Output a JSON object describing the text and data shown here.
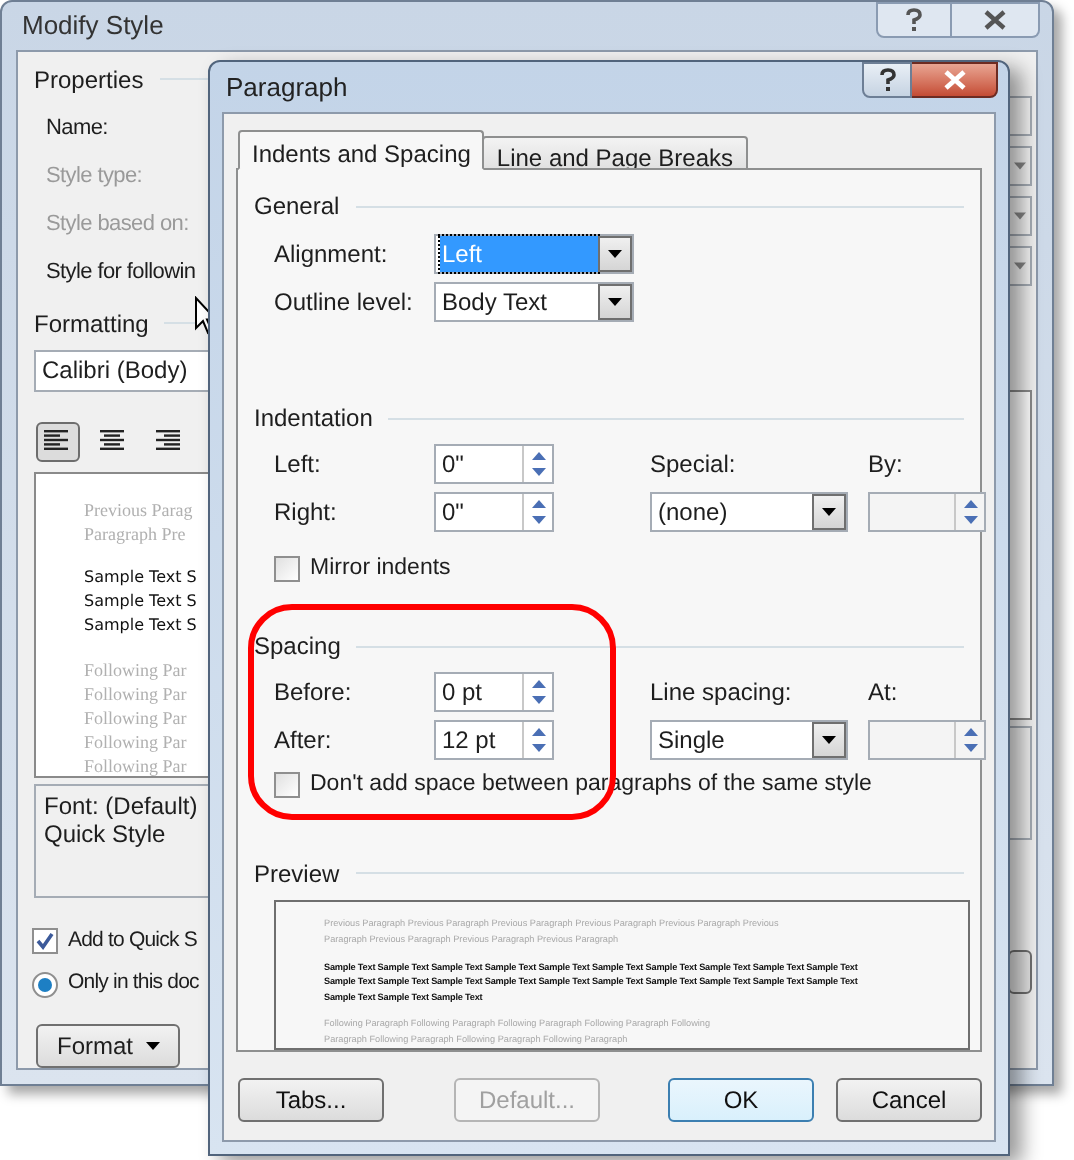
{
  "modify_style": {
    "title": "Modify Style",
    "properties_heading": "Properties",
    "labels": [
      {
        "text": "Name:",
        "disabled": false
      },
      {
        "text": "Style type:",
        "disabled": true
      },
      {
        "text": "Style based on:",
        "disabled": true
      },
      {
        "text": "Style for followin",
        "disabled": false
      }
    ],
    "formatting_heading": "Formatting",
    "font": "Calibri (Body)",
    "align_buttons": [
      {
        "kind": "left",
        "selected": true
      },
      {
        "kind": "center",
        "selected": false
      },
      {
        "kind": "right",
        "selected": false
      }
    ],
    "preview_lines": [
      {
        "kind": "previous",
        "text": "Previous Parag"
      },
      {
        "kind": "previous",
        "text": "Paragraph Pre"
      },
      {
        "kind": "sample",
        "text": "Sample Text S"
      },
      {
        "kind": "sample",
        "text": "Sample Text S"
      },
      {
        "kind": "sample",
        "text": "Sample Text S"
      },
      {
        "kind": "following",
        "text": "Following Par"
      },
      {
        "kind": "following",
        "text": "Following Par"
      },
      {
        "kind": "following",
        "text": "Following Par"
      },
      {
        "kind": "following",
        "text": "Following Par"
      },
      {
        "kind": "following",
        "text": "Following Par"
      }
    ],
    "description": [
      "Font: (Default)",
      "Quick Style"
    ],
    "add_to_quick": {
      "label": "Add to Quick S",
      "checked": true
    },
    "only_in_doc": {
      "label": "Only in this doc",
      "selected": true
    },
    "format_button": "Format"
  },
  "paragraph": {
    "title": "Paragraph",
    "tabs": [
      {
        "label": "Indents and Spacing",
        "selected": true
      },
      {
        "label": "Line and Page Breaks",
        "selected": false
      }
    ],
    "general": {
      "heading": "General",
      "alignment": {
        "label": "Alignment:",
        "value": "Left",
        "focused": true
      },
      "outline_level": {
        "label": "Outline level:",
        "value": "Body Text",
        "focused": false
      }
    },
    "indentation": {
      "heading": "Indentation",
      "left": {
        "label": "Left:",
        "value": "0\""
      },
      "right": {
        "label": "Right:",
        "value": "0\""
      },
      "special": {
        "label": "Special:",
        "value": "(none)",
        "focused": false
      },
      "by": {
        "label": "By:"
      },
      "mirror_indents": {
        "label": "Mirror indents",
        "checked": false
      }
    },
    "spacing": {
      "heading": "Spacing",
      "circled": true,
      "before": {
        "label": "Before:",
        "value": "0 pt"
      },
      "after": {
        "label": "After:",
        "value": "12 pt"
      },
      "line_spacing": {
        "label": "Line spacing:",
        "value": "Single",
        "focused": false
      },
      "at": {
        "label": "At:"
      },
      "dont_add_space": {
        "label": "Don't add space between paragraphs of the same style",
        "checked": false
      }
    },
    "preview": {
      "heading": "Preview",
      "previous": [
        "Previous Paragraph Previous Paragraph Previous Paragraph Previous Paragraph Previous Paragraph Previous",
        "Paragraph Previous Paragraph Previous Paragraph Previous Paragraph"
      ],
      "sample": [
        "Sample Text Sample Text Sample Text Sample Text Sample Text Sample Text Sample Text Sample Text Sample Text Sample Text",
        "Sample Text Sample Text Sample Text Sample Text Sample Text Sample Text Sample Text Sample Text Sample Text Sample Text",
        "Sample Text Sample Text Sample Text"
      ],
      "following": [
        "Following Paragraph Following Paragraph Following Paragraph Following Paragraph Following",
        "Paragraph Following Paragraph Following Paragraph Following Paragraph"
      ]
    },
    "buttons": [
      {
        "label": "Tabs...",
        "disabled": false,
        "default": false
      },
      {
        "label": "Default...",
        "disabled": true,
        "default": false
      },
      {
        "label": "OK",
        "disabled": false,
        "default": true
      },
      {
        "label": "Cancel",
        "disabled": false,
        "default": false
      }
    ]
  }
}
